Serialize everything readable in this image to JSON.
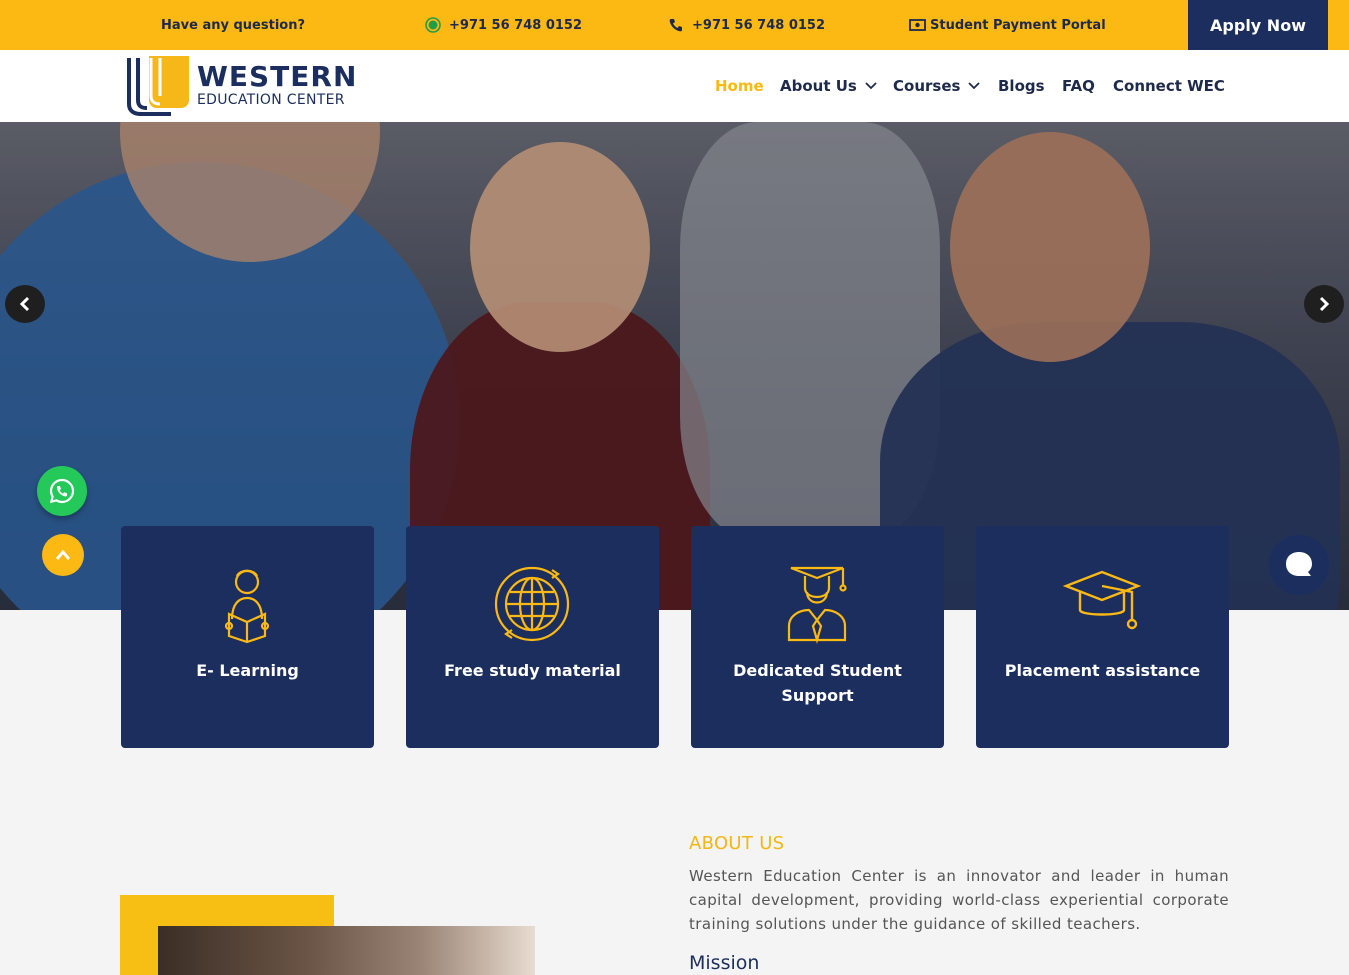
{
  "topbar": {
    "question": "Have any question?",
    "whatsapp": "+971 56 748 0152",
    "phone": "+971 56 748 0152",
    "portal": "Student Payment Portal",
    "apply": "Apply Now"
  },
  "logo": {
    "line1": "WESTERN",
    "line2": "EDUCATION CENTER"
  },
  "nav": {
    "home": "Home",
    "about": "About Us",
    "courses": "Courses",
    "blogs": "Blogs",
    "faq": "FAQ",
    "connect": "Connect WEC"
  },
  "features": [
    {
      "label": "E- Learning",
      "icon": "student-reading-icon"
    },
    {
      "label": "Free study material",
      "icon": "globe-icon"
    },
    {
      "label": "Dedicated Student Support",
      "icon": "graduate-icon"
    },
    {
      "label": "Placement assistance",
      "icon": "graduation-cap-icon"
    }
  ],
  "about": {
    "title": "ABOUT US",
    "text": "Western Education Center is an innovator and leader in human capital development, providing world-class experiential corporate training solutions under the guidance of skilled teachers.",
    "mission": "Mission"
  },
  "colors": {
    "accent": "#fcb813",
    "navy": "#1c2e5e"
  }
}
